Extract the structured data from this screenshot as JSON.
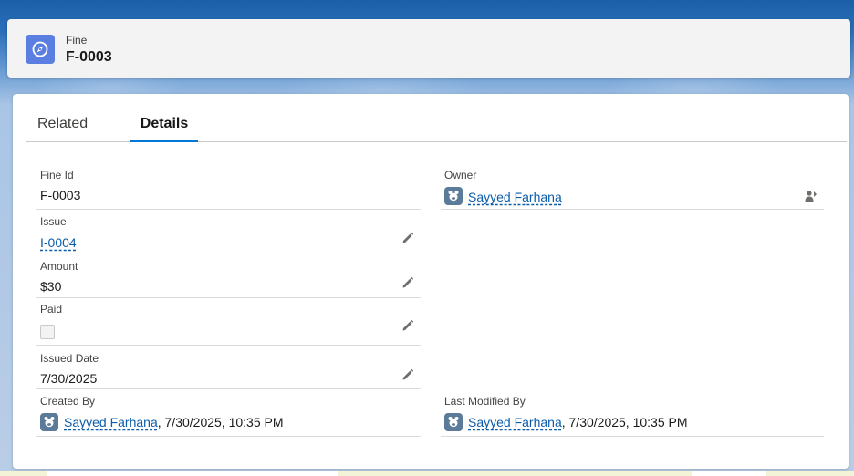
{
  "record": {
    "object_type": "Fine",
    "name": "F-0003",
    "icon": "compass-icon",
    "icon_color": "#5a7fe0"
  },
  "tabs": [
    {
      "label": "Related",
      "active": false
    },
    {
      "label": "Details",
      "active": true
    }
  ],
  "accent_color": "#0176d3",
  "fields": {
    "fine_id": {
      "label": "Fine Id",
      "value": "F-0003"
    },
    "owner": {
      "label": "Owner",
      "value": "Sayyed Farhana"
    },
    "issue": {
      "label": "Issue",
      "value": "I-0004"
    },
    "amount": {
      "label": "Amount",
      "value": "$30"
    },
    "paid": {
      "label": "Paid",
      "checked": false
    },
    "issued_date": {
      "label": "Issued Date",
      "value": "7/30/2025"
    },
    "created_by": {
      "label": "Created By",
      "user": "Sayyed Farhana",
      "timestamp": ", 7/30/2025, 10:35 PM"
    },
    "last_modified_by": {
      "label": "Last Modified By",
      "user": "Sayyed Farhana",
      "timestamp": ", 7/30/2025, 10:35 PM"
    }
  }
}
